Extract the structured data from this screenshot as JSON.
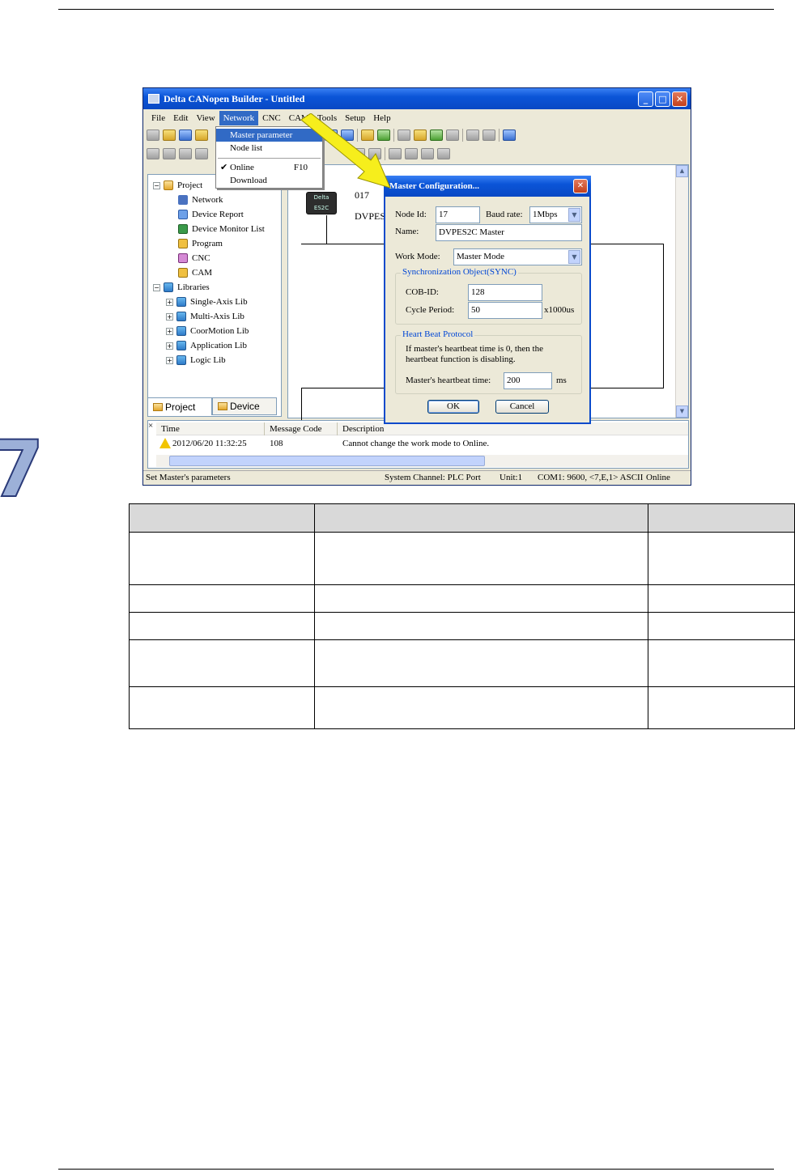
{
  "page": {
    "chapter_number": "7"
  },
  "window": {
    "title": "Delta CANopen Builder - Untitled",
    "minimize": "_",
    "maximize": "□",
    "close": "✕"
  },
  "menubar": {
    "items": [
      "File",
      "Edit",
      "View",
      "Network",
      "CNC",
      "CAM",
      "Tools",
      "Setup",
      "Help"
    ]
  },
  "network_menu": {
    "items": [
      {
        "label": "Master parameter",
        "shortcut": ""
      },
      {
        "label": "Node list",
        "shortcut": ""
      },
      {
        "label": "Online",
        "shortcut": "F10",
        "checked": true
      },
      {
        "label": "Download",
        "shortcut": ""
      }
    ],
    "check_mark": "✔"
  },
  "tree": {
    "expand": "−",
    "collapse": "+",
    "project": "Project",
    "project_items": [
      "Network",
      "Device Report",
      "Device Monitor List",
      "Program",
      "CNC",
      "CAM"
    ],
    "libraries": "Libraries",
    "library_items": [
      "Single-Axis Lib",
      "Multi-Axis Lib",
      "CoorMotion Lib",
      "Application Lib",
      "Logic Lib"
    ]
  },
  "tabs": {
    "project": "Project",
    "device": "Device"
  },
  "network_view": {
    "node_id": "017",
    "node_name": "DVPES",
    "node_badge": "Delta ES2C"
  },
  "dialog": {
    "title": "Master Configuration...",
    "close": "✕",
    "node_id_label": "Node Id:",
    "node_id_value": "17",
    "baud_rate_label": "Baud rate:",
    "baud_rate_value": "1Mbps",
    "name_label": "Name:",
    "name_value": "DVPES2C Master",
    "work_mode_label": "Work Mode:",
    "work_mode_value": "Master Mode",
    "sync_group": "Synchronization Object(SYNC)",
    "cob_id_label": "COB-ID:",
    "cob_id_value": "128",
    "cycle_period_label": "Cycle Period:",
    "cycle_period_value": "50",
    "cycle_period_unit": "x1000us",
    "heartbeat_group": "Heart Beat Protocol",
    "heartbeat_note": "If master's heartbeat time is 0, then the heartbeat function is disabling.",
    "heartbeat_time_label": "Master's heartbeat time:",
    "heartbeat_time_value": "200",
    "heartbeat_time_unit": "ms",
    "ok": "OK",
    "cancel": "Cancel"
  },
  "messages": {
    "close": "×",
    "columns": [
      "Time",
      "Message Code",
      "Description"
    ],
    "rows": [
      {
        "time": "2012/06/20  11:32:25",
        "code": "108",
        "description": "Cannot change the work mode to Online."
      }
    ]
  },
  "statusbar": {
    "hint": "Set Master's parameters",
    "channel": "System Channel: PLC Port",
    "unit": "Unit:1",
    "com": "COM1: 9600, <7,E,1> ASCII",
    "state": "Online"
  },
  "doc_table": {
    "rows": 6
  }
}
